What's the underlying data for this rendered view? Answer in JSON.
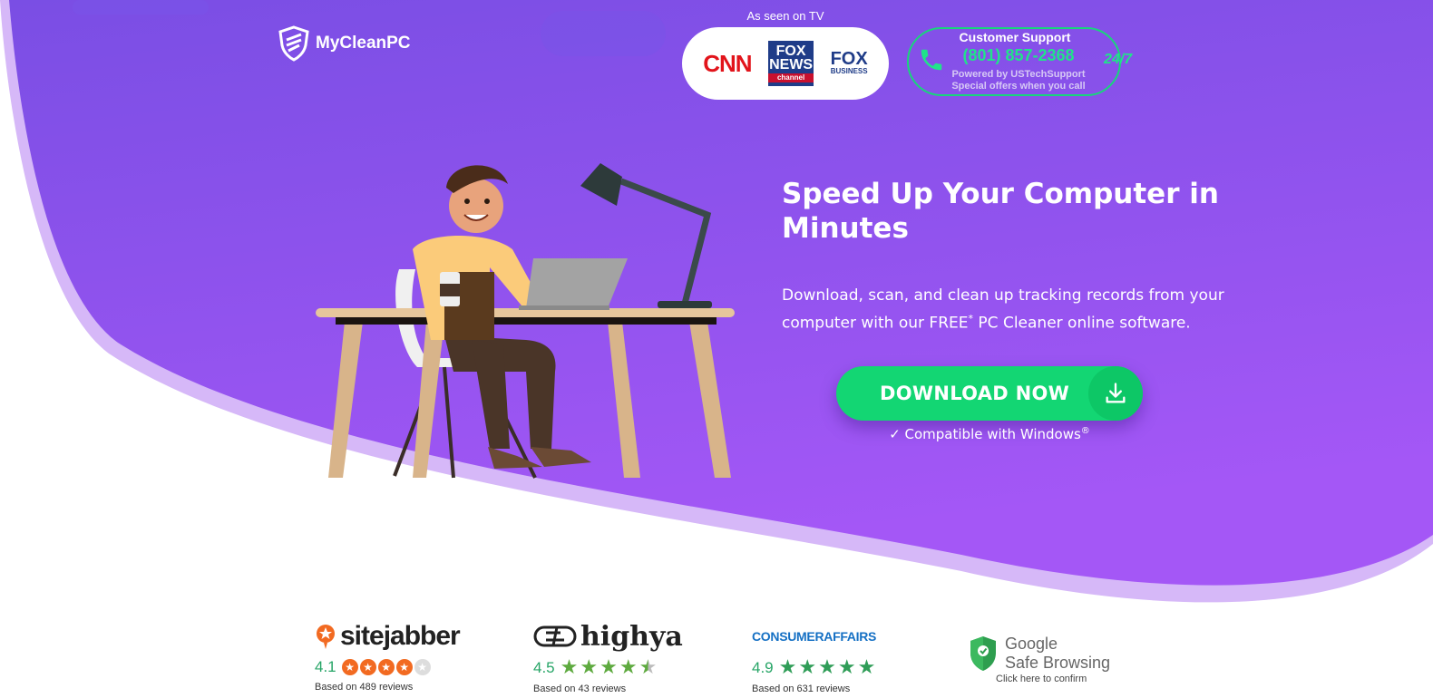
{
  "header": {
    "brand": "MyCleanPC",
    "as_seen_on": "As seen on TV",
    "tv_logos": {
      "cnn": "CNN",
      "fox_news_top": "FOX",
      "fox_news_mid": "NEWS",
      "fox_news_bottom": "channel",
      "fox_business_top": "FOX",
      "fox_business_bottom": "BUSINESS"
    },
    "support": {
      "title": "Customer Support",
      "phone": "(801) 857-2368",
      "powered_by": "Powered by USTechSupport",
      "offers": "Special offers when you call",
      "availability": "24/7"
    }
  },
  "hero": {
    "headline": "Speed Up Your Computer in Minutes",
    "description_part1": "Download, scan, and clean up tracking records from your computer with our FREE",
    "description_sup": "*",
    "description_part2": " PC Cleaner online software.",
    "download_label": "DOWNLOAD NOW",
    "compat_text": "✓ Compatible with Windows",
    "compat_sup": "®"
  },
  "reviews": [
    {
      "name": "sitejabber",
      "rating": "4.1",
      "based_on": "Based on 489 reviews"
    },
    {
      "name": "highya",
      "rating": "4.5",
      "based_on": "Based on 43 reviews"
    },
    {
      "name": "CONSUMERAFFAIRS",
      "rating": "4.9",
      "based_on": "Based on 631 reviews"
    },
    {
      "name_line1": "Google",
      "name_line2": "Safe Browsing",
      "confirm": "Click here to confirm"
    }
  ],
  "colors": {
    "purple_top": "#7b4de3",
    "purple_bottom": "#a456f5",
    "green": "#13d673",
    "rating_green": "#27a567",
    "sitejabber_orange": "#f26a21"
  }
}
